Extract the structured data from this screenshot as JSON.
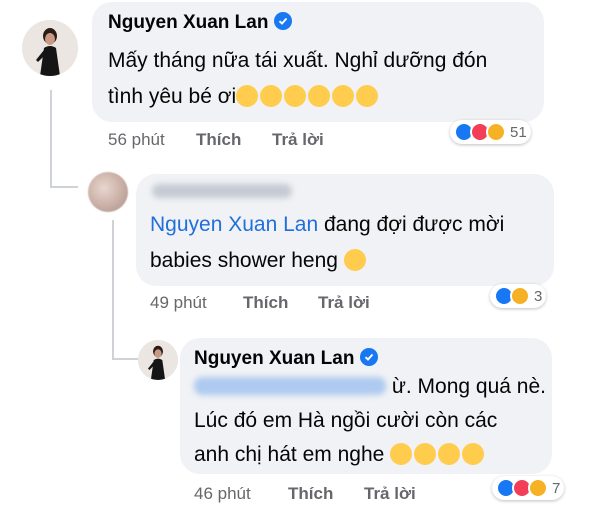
{
  "comments": [
    {
      "author": "Nguyen Xuan Lan",
      "line1": "Mấy tháng nữa tái xuất. Nghỉ dưỡng đón",
      "line2": "tình yêu bé ơi",
      "emojis": [
        "smiling-face-with-hearts",
        "smiling-face-with-hearts",
        "smiling-face-with-hearts",
        "smiling-face-with-hearts",
        "smiling-face-with-hearts",
        "smiling-face-with-hearts"
      ],
      "time": "56 phút",
      "like": "Thích",
      "reply": "Trả lời",
      "reaction_count": "51",
      "reactions": [
        "like",
        "love",
        "care"
      ]
    },
    {
      "author": "Nhat Binh Nguyen",
      "mention": "Nguyen Xuan Lan",
      "line1_rest": " đang đợi được mời",
      "line2": "babies shower heng",
      "emojis": [
        "winking-face-with-tongue"
      ],
      "time": "49 phút",
      "like": "Thích",
      "reply": "Trả lời",
      "reaction_count": "3",
      "reactions": [
        "like",
        "care"
      ]
    },
    {
      "author": "Nguyen Xuan Lan",
      "line1_rest": " ừ. Mong quá nè.",
      "line2": "Lúc đó em Hà ngồi cười còn các",
      "line3": "anh chị hát em nghe",
      "emojis": [
        "smiling-face-with-hearts",
        "smiling-face-with-hearts",
        "grinning-face",
        "grinning-face"
      ],
      "time": "46 phút",
      "like": "Thích",
      "reply": "Trả lời",
      "reaction_count": "7",
      "reactions": [
        "like",
        "love",
        "care"
      ]
    }
  ],
  "colors": {
    "mention": "#216fdb",
    "meta": "#65676b",
    "bubble": "#f0f2f5",
    "verified": "#1877f2"
  }
}
